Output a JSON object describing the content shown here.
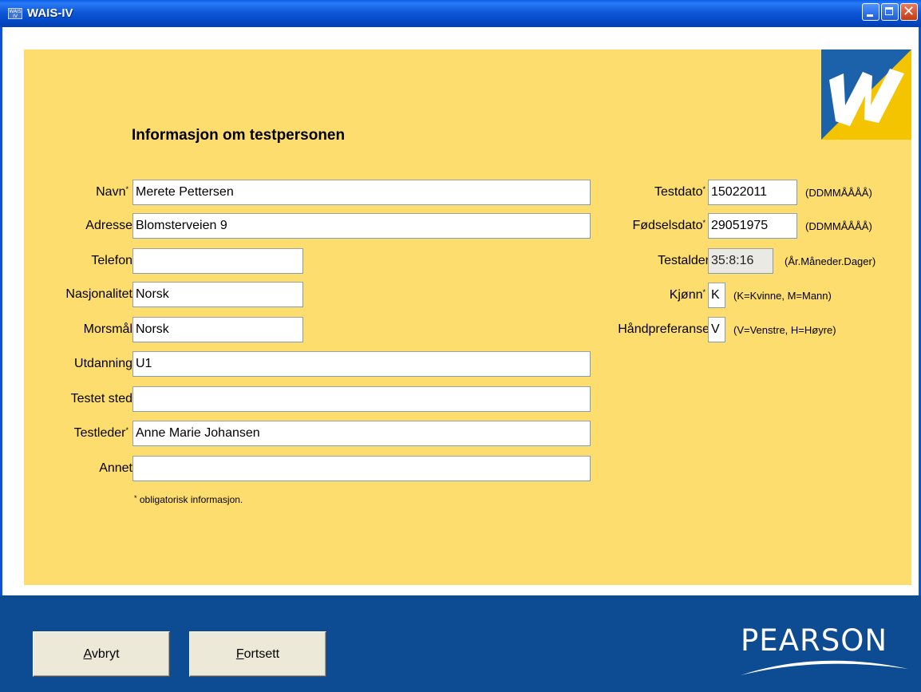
{
  "window": {
    "title": "WAIS-IV",
    "icon_text": "WAIS IV"
  },
  "page": {
    "heading": "Informasjon om testpersonen",
    "required_note": "obligatorisk informasjon."
  },
  "left_fields": [
    {
      "label": "Navn",
      "value": "Merete Pettersen",
      "required": true
    },
    {
      "label": "Adresse",
      "value": "Blomsterveien 9",
      "required": false
    },
    {
      "label": "Telefon",
      "value": "",
      "required": false
    },
    {
      "label": "Nasjonalitet",
      "value": "Norsk",
      "required": false
    },
    {
      "label": "Morsmål",
      "value": "Norsk",
      "required": false
    },
    {
      "label": "Utdanning",
      "value": "U1",
      "required": false
    },
    {
      "label": "Testet sted",
      "value": "",
      "required": false
    },
    {
      "label": "Testleder",
      "value": "Anne Marie Johansen",
      "required": true
    },
    {
      "label": "Annet",
      "value": "",
      "required": false
    }
  ],
  "right_fields": [
    {
      "label": "Testdato",
      "value": "15022011",
      "hint": "(DDMMÅÅÅÅ)",
      "required": true
    },
    {
      "label": "Fødselsdato",
      "value": "29051975",
      "hint": "(DDMMÅÅÅÅ)",
      "required": true
    },
    {
      "label": "Testalder",
      "value": "35:8:16",
      "hint": "(År.Måneder.Dager)",
      "required": false
    },
    {
      "label": "Kjønn",
      "value": "K",
      "hint": "(K=Kvinne, M=Mann)",
      "required": true
    },
    {
      "label": "Håndpreferanse",
      "value": "V",
      "hint": "(V=Venstre, H=Høyre)",
      "required": false
    }
  ],
  "buttons": {
    "cancel": "Avbryt",
    "cancel_key": "A",
    "cancel_rest": "vbryt",
    "continue": "Fortsett",
    "continue_key": "F",
    "continue_rest": "ortsett"
  },
  "brand": {
    "name": "PEARSON"
  },
  "colors": {
    "panel": "#fedd6f",
    "footer": "#0d4c92",
    "logo_blue": "#1c62ab",
    "logo_yellow": "#f5c400"
  }
}
